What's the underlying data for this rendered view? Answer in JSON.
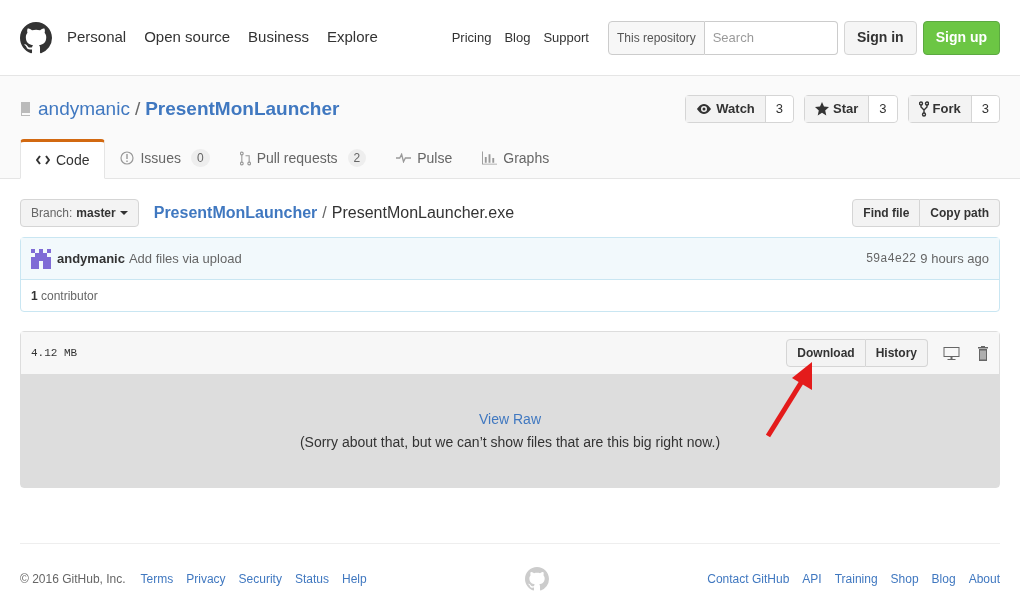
{
  "header": {
    "nav": [
      "Personal",
      "Open source",
      "Business",
      "Explore"
    ],
    "links": [
      "Pricing",
      "Blog",
      "Support"
    ],
    "search": {
      "scope": "This repository",
      "placeholder": "Search"
    },
    "sign_in": "Sign in",
    "sign_up": "Sign up"
  },
  "repo": {
    "owner": "andymanic",
    "separator": "/",
    "name": "PresentMonLauncher",
    "actions": [
      {
        "kind": "watch",
        "label": "Watch",
        "count": "3"
      },
      {
        "kind": "star",
        "label": "Star",
        "count": "3"
      },
      {
        "kind": "fork",
        "label": "Fork",
        "count": "3"
      }
    ],
    "tabs": [
      {
        "kind": "code",
        "label": "Code",
        "selected": true
      },
      {
        "kind": "issues",
        "label": "Issues",
        "count": "0",
        "selected": false
      },
      {
        "kind": "pulls",
        "label": "Pull requests",
        "count": "2",
        "selected": false
      },
      {
        "kind": "pulse",
        "label": "Pulse",
        "selected": false
      },
      {
        "kind": "graphs",
        "label": "Graphs",
        "selected": false
      }
    ]
  },
  "file_nav": {
    "branch_label": "Branch:",
    "branch": "master",
    "path_root": "PresentMonLauncher",
    "separator": "/",
    "file": "PresentMonLauncher.exe",
    "buttons": [
      "Find file",
      "Copy path"
    ]
  },
  "commit": {
    "author": "andymanic",
    "message": "Add files via upload",
    "sha": "59a4e22",
    "time": "9 hours ago",
    "contributors": "1",
    "contributors_label": "contributor"
  },
  "file": {
    "size": "4.12 MB",
    "buttons": [
      "Download",
      "History"
    ],
    "view_raw": "View Raw",
    "notice": "(Sorry about that, but we can’t show files that are this big right now.)"
  },
  "footer": {
    "copyright": "© 2016 GitHub, Inc.",
    "left_links": [
      "Terms",
      "Privacy",
      "Security",
      "Status",
      "Help"
    ],
    "right_links": [
      "Contact GitHub",
      "API",
      "Training",
      "Shop",
      "Blog",
      "About"
    ]
  }
}
